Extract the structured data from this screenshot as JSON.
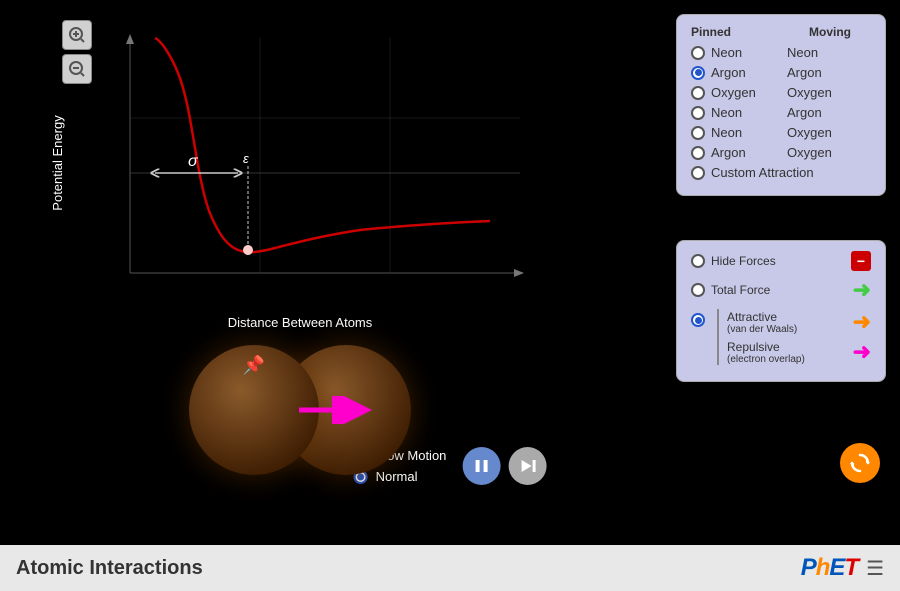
{
  "app": {
    "title": "Atomic Interactions"
  },
  "graph": {
    "y_label": "Potential Energy",
    "x_label": "Distance Between Atoms",
    "sigma_label": "σ",
    "epsilon_label": "ε"
  },
  "molecules": {
    "header_col1": "Pinned",
    "header_col2": "Moving",
    "pairs": [
      {
        "col1": "Neon",
        "col2": "Neon",
        "selected": false
      },
      {
        "col1": "Argon",
        "col2": "Argon",
        "selected": true
      },
      {
        "col1": "Oxygen",
        "col2": "Oxygen",
        "selected": false
      },
      {
        "col1": "Neon",
        "col2": "Argon",
        "selected": false
      },
      {
        "col1": "Neon",
        "col2": "Oxygen",
        "selected": false
      },
      {
        "col1": "Argon",
        "col2": "Oxygen",
        "selected": false
      },
      {
        "col1": "Custom Attraction",
        "col2": "",
        "selected": false
      }
    ]
  },
  "forces": {
    "hide_forces_label": "Hide Forces",
    "total_force_label": "Total Force",
    "attractive_label": "Attractive",
    "attractive_sublabel": "(van der Waals)",
    "repulsive_label": "Repulsive",
    "repulsive_sublabel": "(electron overlap)",
    "selected": "components"
  },
  "controls": {
    "slow_motion_label": "Slow Motion",
    "normal_label": "Normal",
    "selected_speed": "normal",
    "pause_label": "⏸",
    "step_label": "⏭"
  },
  "zoom": {
    "zoom_in_label": "+",
    "zoom_out_label": "−"
  },
  "phet": {
    "logo": "PhET"
  }
}
